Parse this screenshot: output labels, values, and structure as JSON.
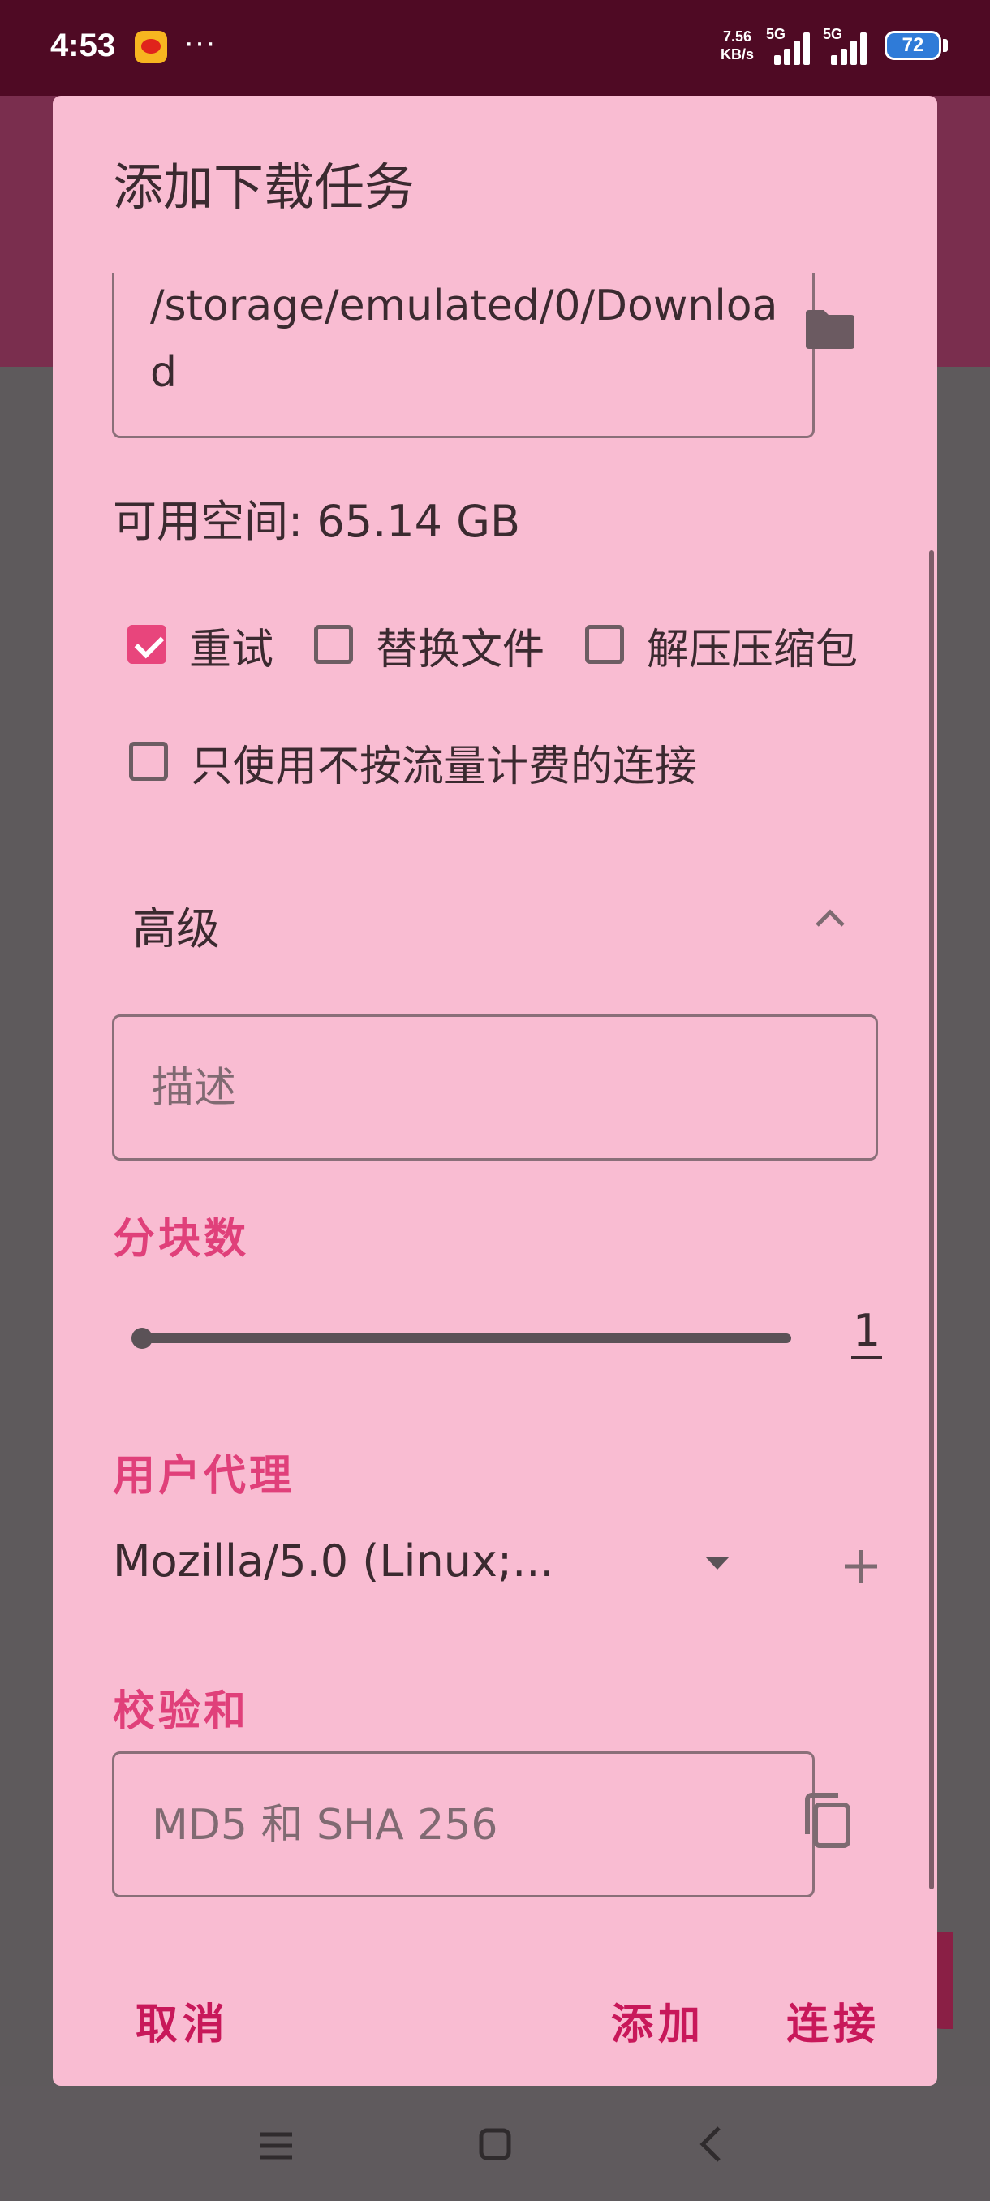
{
  "status_bar": {
    "time": "4:53",
    "dots": "···",
    "net_speed_value": "7.56",
    "net_speed_unit": "KB/s",
    "signal1_label": "5G",
    "signal2_label": "5G",
    "battery": "72"
  },
  "dialog": {
    "title": "添加下载任务",
    "path": "/storage/emulated/0/Download",
    "free_space": "可用空间: 65.14 GB",
    "checkboxes": {
      "retry": {
        "label": "重试",
        "checked": true
      },
      "replace": {
        "label": "替换文件",
        "checked": false
      },
      "unzip": {
        "label": "解压压缩包",
        "checked": false
      },
      "unmetered": {
        "label": "只使用不按流量计费的连接",
        "checked": false
      }
    },
    "advanced": "高级",
    "description_placeholder": "描述",
    "chunks_label": "分块数",
    "chunks_value": "1",
    "chunks_fraction": 0,
    "user_agent_label": "用户代理",
    "user_agent_value": "Mozilla/5.0 (Linux;...",
    "checksum_label": "校验和",
    "checksum_placeholder": "MD5 和 SHA 256",
    "actions": {
      "cancel": "取消",
      "add": "添加",
      "connect": "连接"
    }
  },
  "colors": {
    "dialog_bg": "#f9bcd2",
    "accent": "#e0407a",
    "button_text": "#c8185a",
    "status_bar": "#4f0a24"
  },
  "icons": [
    "weibo-icon",
    "folder-icon",
    "chevron-up-icon",
    "dropdown-icon",
    "plus-icon",
    "copy-icon"
  ]
}
